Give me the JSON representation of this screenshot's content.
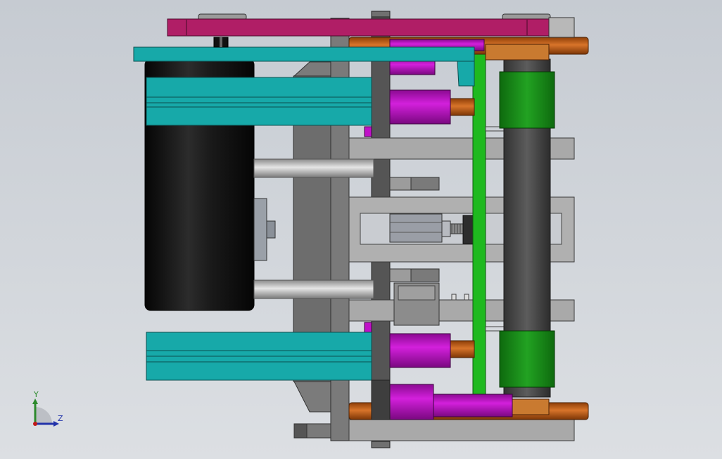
{
  "viewport": {
    "background_top": "#c6cbd2",
    "background_bottom": "#dcdfe3"
  },
  "model_colors": {
    "magenta_bar": "#b01e66",
    "teal_profile": "#17a9a9",
    "purple_cylinder": "#c011c8",
    "copper_rod": "#c65e14",
    "green_roller": "#1a8a1a",
    "green_board": "#1fb91f",
    "gray_plate": "#a8a8a8",
    "dark_plate": "#6a6a6a",
    "motor_black": "#151515"
  },
  "triad": {
    "y_label": "Y",
    "z_label": "Z",
    "icon": "coordinate-triad-icon"
  }
}
